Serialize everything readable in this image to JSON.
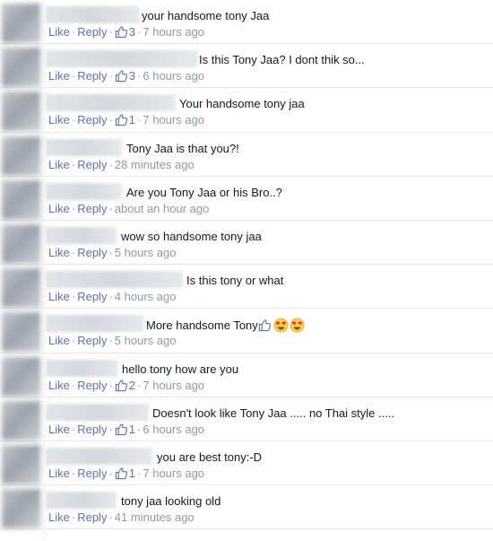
{
  "actions": {
    "like": "Like",
    "reply": "Reply",
    "sep": "·"
  },
  "comments": [
    {
      "text": "your handsome tony Jaa",
      "likes": "3",
      "time": "7 hours ago"
    },
    {
      "text": "Is this Tony Jaa? I dont thik so...",
      "likes": "3",
      "time": "6 hours ago"
    },
    {
      "text": "Your handsome tony jaa",
      "likes": "1",
      "time": "7 hours ago"
    },
    {
      "text": "Tony Jaa is that you?!",
      "likes": "",
      "time": "28 minutes ago"
    },
    {
      "text": "Are you Tony Jaa or his Bro..?",
      "likes": "",
      "time": "about an hour ago"
    },
    {
      "text": "wow so handsome tony jaa",
      "likes": "",
      "time": "5 hours ago"
    },
    {
      "text": "Is this tony or what",
      "likes": "",
      "time": "4 hours ago"
    },
    {
      "text": "More handsome Tony",
      "likes": "",
      "time": "5 hours ago",
      "trailing_icons": [
        "thumbs-up-icon",
        "heart-eyes-emoji-icon",
        "heart-eyes-emoji-icon"
      ]
    },
    {
      "text": "hello tony how are you",
      "likes": "2",
      "time": "7 hours ago"
    },
    {
      "text": "Doesn't look like Tony Jaa ..... no Thai style .....",
      "likes": "1",
      "time": "6 hours ago"
    },
    {
      "text": "you are best tony:-D",
      "likes": "1",
      "time": "7 hours ago"
    },
    {
      "text": "tony jaa looking old",
      "likes": "",
      "time": "41 minutes ago"
    }
  ],
  "colors": {
    "link": "#5a72b5",
    "meta": "#9197a3",
    "text": "#141823",
    "divider": "#e5e6e9"
  }
}
